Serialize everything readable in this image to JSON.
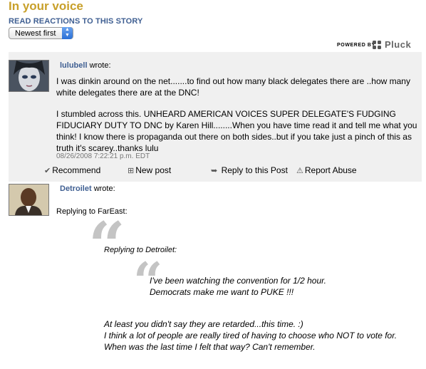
{
  "header": {
    "title": "In your voice",
    "read_reactions": "READ REACTIONS TO THIS STORY",
    "sort_value": "Newest first",
    "powered_by": "POWERED BY",
    "brand": "Pluck"
  },
  "posts": [
    {
      "author": "lulubell",
      "wrote": "wrote:",
      "paragraph1": "I was dinkin around on the net.......to find out how many black delegates there are ..how many white delegates there are at the DNC!",
      "paragraph2": "I stumbled across this. UNHEARD AMERICAN VOICES SUPER DELEGATE'S FUDGING FIDUCIARY DUTY TO DNC by Karen Hill........When you have time read it and tell me what you think! I know there is propaganda out there on both sides..but if you take just a pinch of this as truth it's scarey..thanks lulu",
      "timestamp": "08/26/2008 7:22:21 p.m. EDT",
      "actions": {
        "recommend": "Recommend",
        "new_post": "New post",
        "reply": "Reply to this Post",
        "report": "Report Abuse"
      }
    },
    {
      "author": "Detroilet",
      "wrote": "wrote:",
      "replying_to": "Replying to FarEast:",
      "quote_replying": "Replying to Detroilet:",
      "inner_quote_line1": "I've been watching the convention for 1/2 hour.",
      "inner_quote_line2": "Democrats make me want to PUKE !!!",
      "body_line1": "At least you didn't say they are retarded...this time. :)",
      "body_line2": "I think a lot of people are really tired of having to choose who NOT to vote for. When was the last time I felt that way? Can't remember."
    }
  ],
  "colors": {
    "title": "#c8a02a",
    "link": "#3f5f92",
    "post_bg": "#f0f0f0"
  }
}
